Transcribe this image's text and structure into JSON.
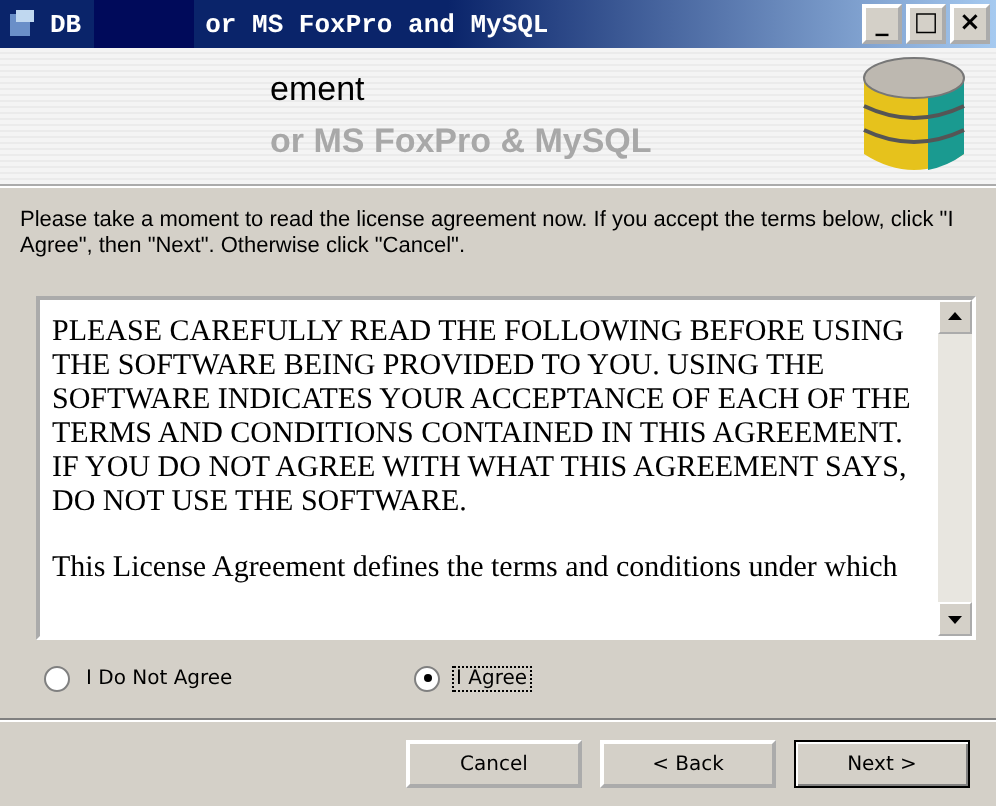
{
  "window": {
    "title_parts": [
      "DB",
      "or MS FoxPro and MySQL"
    ],
    "controls": [
      "_",
      "□",
      "×"
    ]
  },
  "banner": {
    "title": "ement",
    "subtitle": "or MS FoxPro & MySQL"
  },
  "instructions": "Please take a moment to read the license agreement now. If you accept the terms below, click \"I Agree\", then \"Next\". Otherwise click \"Cancel\".",
  "license": {
    "paragraphs": [
      "PLEASE CAREFULLY READ THE FOLLOWING BEFORE USING THE SOFTWARE BEING PROVIDED TO YOU. USING THE SOFTWARE INDICATES YOUR ACCEPTANCE OF EACH OF THE TERMS AND CONDITIONS CONTAINED IN THIS AGREEMENT. IF YOU DO NOT AGREE WITH WHAT THIS AGREEMENT SAYS, DO NOT USE THE SOFTWARE.",
      "This License Agreement defines the terms and conditions under which"
    ]
  },
  "options": [
    {
      "label": "I Do Not Agree",
      "selected": false
    },
    {
      "label": "I Agree",
      "selected": true
    }
  ],
  "buttons": [
    {
      "label": "Cancel",
      "kind": "plain"
    },
    {
      "label": "< Back",
      "kind": "plain"
    },
    {
      "label": "Next >",
      "kind": "default"
    }
  ]
}
